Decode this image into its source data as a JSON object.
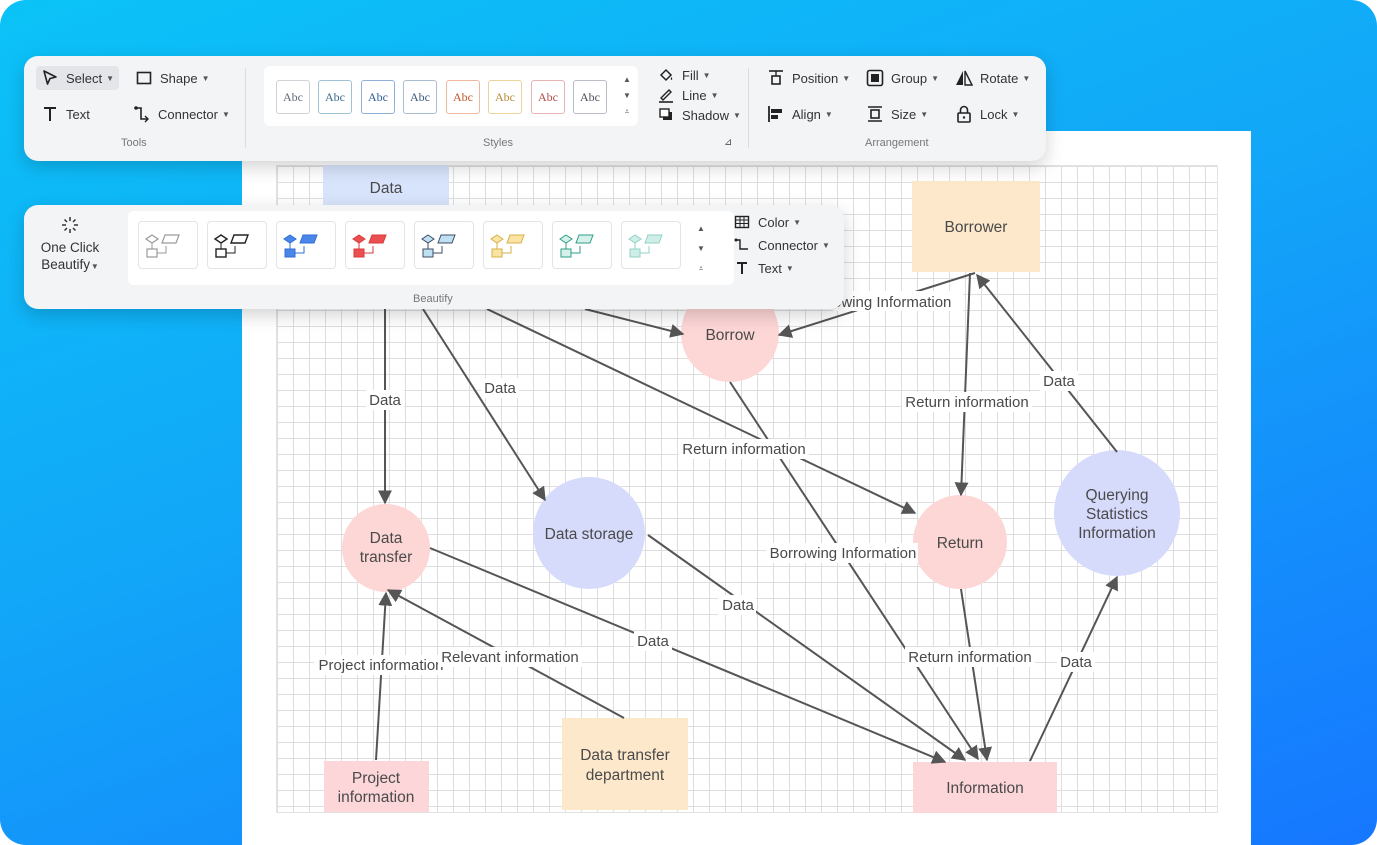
{
  "toolbar": {
    "tools_group": "Tools",
    "styles_group": "Styles",
    "arrangement_group": "Arrangement",
    "select": "Select",
    "shape": "Shape",
    "text": "Text",
    "connector": "Connector",
    "style_swatches": [
      {
        "label": "Abc",
        "color": "#5f6a78"
      },
      {
        "label": "Abc",
        "color": "#3a6a8a"
      },
      {
        "label": "Abc",
        "color": "#2d5b9a"
      },
      {
        "label": "Abc",
        "color": "#3c5a7a"
      },
      {
        "label": "Abc",
        "color": "#c0562b"
      },
      {
        "label": "Abc",
        "color": "#b98a36"
      },
      {
        "label": "Abc",
        "color": "#b44a4a"
      },
      {
        "label": "Abc",
        "color": "#4a4f59"
      }
    ],
    "fill": "Fill",
    "line": "Line",
    "shadow": "Shadow",
    "position": "Position",
    "group": "Group",
    "rotate": "Rotate",
    "align": "Align",
    "size": "Size",
    "lock": "Lock"
  },
  "beautify": {
    "button_line1": "One Click",
    "button_line2": "Beautify",
    "group": "Beautify",
    "color": "Color",
    "connector": "Connector",
    "text": "Text",
    "themes": [
      {
        "stroke": "#9a9a9a",
        "fill": "#ffffff"
      },
      {
        "stroke": "#222222",
        "fill": "#ffffff"
      },
      {
        "stroke": "#2f6fd6",
        "fill": "#4a86e8"
      },
      {
        "stroke": "#d93a3a",
        "fill": "#ea5050"
      },
      {
        "stroke": "#3d4d66",
        "fill": "#bfe0f3"
      },
      {
        "stroke": "#d4b04a",
        "fill": "#fbe3a4"
      },
      {
        "stroke": "#2f9e8a",
        "fill": "#d6f1ea"
      },
      {
        "stroke": "#8fd3c4",
        "fill": "#cfeee7"
      }
    ]
  },
  "colors": {
    "circle_pink": "#fdd6d6",
    "circle_blue": "#d6dbfc",
    "rect_peach": "#fde8cc",
    "rect_pink": "#fdd6d9",
    "rect_blue": "#d8e4fb",
    "edge": "#555555"
  },
  "diagram": {
    "nodes": {
      "data_top": "Data",
      "borrower": "Borrower",
      "borrow": "Borrow",
      "data_transfer_1": "Data",
      "data_transfer_2": "transfer",
      "data_storage": "Data storage",
      "return": "Return",
      "querying_1": "Querying",
      "querying_2": "Statistics",
      "querying_3": "Information",
      "project_1": "Project",
      "project_2": "information",
      "dtd_1": "Data transfer",
      "dtd_2": "department",
      "information": "Information"
    },
    "edges": {
      "borrowing_info_top": "owing Information",
      "data_1": "Data",
      "data_2": "Data",
      "return_info_1": "Return information",
      "data_3": "Data",
      "return_info_2": "Return information",
      "borrowing_info_2": "Borrowing Information",
      "data_4": "Data",
      "data_5": "Data",
      "project_info": "Project information",
      "relevant_info": "Relevant information",
      "return_info_3": "Return information",
      "data_6": "Data"
    }
  }
}
